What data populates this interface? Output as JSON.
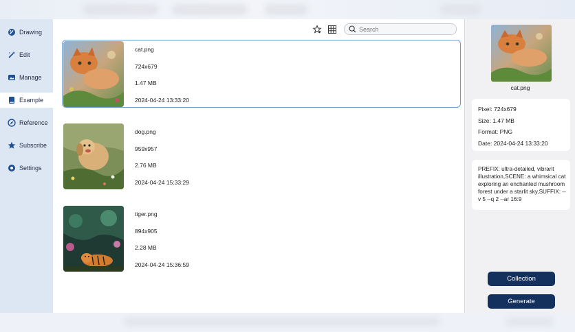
{
  "sidebar": {
    "items": [
      {
        "label": "Drawing",
        "icon": "brush-icon",
        "active": false
      },
      {
        "label": "Edit",
        "icon": "magic-wand-icon",
        "active": false
      },
      {
        "label": "Manage",
        "icon": "image-manage-icon",
        "active": false
      },
      {
        "label": "Example",
        "icon": "book-icon",
        "active": true
      },
      {
        "label": "Reference",
        "icon": "compass-icon",
        "active": false
      },
      {
        "label": "Subscribe",
        "icon": "star-badge-icon",
        "active": false
      },
      {
        "label": "Settings",
        "icon": "gear-icon",
        "active": false
      }
    ]
  },
  "toolbar": {
    "search_placeholder": "Search",
    "icons": [
      "favorite-icon",
      "grid-view-icon",
      "search-icon"
    ]
  },
  "files": [
    {
      "name": "cat.png",
      "dimensions": "724x679",
      "size": "1.47 MB",
      "date": "2024-04-24 13:33:20",
      "selected": true
    },
    {
      "name": "dog.png",
      "dimensions": "959x957",
      "size": "2.76 MB",
      "date": "2024-04-24 15:33:29",
      "selected": false
    },
    {
      "name": "tiger.png",
      "dimensions": "894x905",
      "size": "2.28 MB",
      "date": "2024-04-24 15:36:59",
      "selected": false
    }
  ],
  "details": {
    "filename": "cat.png",
    "pixel": "Pixel: 724x679",
    "size": "Size: 1.47 MB",
    "format": "Format: PNG",
    "date": "Date: 2024-04-24 13:33:20",
    "prompt": "PREFIX: ultra-detailed, vibrant illustration,SCENE: a whimsical cat exploring an enchanted mushroom forest under a starlit sky,SUFFIX: --v 5 --q 2 --ar 16:9"
  },
  "actions": {
    "collection_label": "Collection",
    "generate_label": "Generate"
  },
  "colors": {
    "sidebar_bg": "#dde7f3",
    "accent": "#14305c",
    "selection_border": "#6f9ad0"
  }
}
